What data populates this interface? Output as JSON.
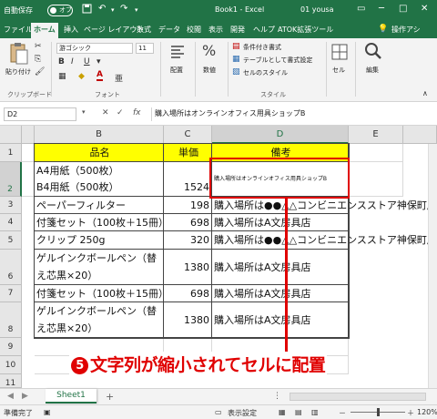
{
  "titlebar": {
    "autosave_label": "自動保存",
    "autosave_state": "オフ",
    "doc_title": "Book1 - Excel",
    "user": "01 yousa",
    "save_icon": "save-icon",
    "undo_icon": "undo-icon",
    "redo_icon": "redo-icon"
  },
  "ribbon_tabs": [
    "ファイル",
    "ホーム",
    "挿入",
    "ページ レイアウト",
    "数式",
    "データ",
    "校閲",
    "表示",
    "開発",
    "ヘルプ",
    "ATOK拡張ツール",
    "操作アシ"
  ],
  "active_tab": "ホーム",
  "ribbon": {
    "paste_label": "貼り付け",
    "clipboard_label": "クリップボード",
    "font_name": "游ゴシック",
    "font_size": "11",
    "bold": "B",
    "italic": "I",
    "underline": "U",
    "font_color_glyph": "A",
    "font_label": "フォント",
    "alignment_label": "配置",
    "number_label": "数値",
    "number_format_glyph": "%",
    "cond_format_label": "条件付き書式",
    "table_format_label": "テーブルとして書式設定",
    "cell_styles_label": "セルのスタイル",
    "styles_label": "スタイル",
    "cells_label": "セル",
    "editing_label": "編集"
  },
  "formula_bar": {
    "name_box": "D2",
    "fx": "fx",
    "content": "購入場所はオンラインオフィス用具ショップB"
  },
  "sheet": {
    "columns": [
      "B",
      "C",
      "D",
      "E"
    ],
    "selected_column": "D",
    "selected_row": "2",
    "headers": {
      "b": "品名",
      "c": "単価",
      "d": "備考"
    },
    "rows": [
      {
        "num": "1",
        "b": "",
        "c": "",
        "d": ""
      },
      {
        "num": "2",
        "b": "A4用紙（500枚）\nB4用紙（500枚）",
        "c": "1524",
        "d": "購入場所はオンラインオフィス用具ショップB"
      },
      {
        "num": "3",
        "b": "ペーパーフィルター",
        "c": "198",
        "d": "購入場所は●●△△コンビニエンスストア神保町店"
      },
      {
        "num": "4",
        "b": "付箋セット（100枚＋15冊）",
        "c": "698",
        "d": "購入場所はA文房具店"
      },
      {
        "num": "5",
        "b": "クリップ 250g",
        "c": "320",
        "d": "購入場所は●●△△コンビニエンスストア神保町店"
      },
      {
        "num": "6",
        "b": "ゲルインクボールペン（替え芯黒×20）",
        "c": "1380",
        "d": "購入場所はA文房具店"
      },
      {
        "num": "7",
        "b": "付箋セット（100枚＋15冊）",
        "c": "698",
        "d": "購入場所はA文房具店"
      },
      {
        "num": "8",
        "b": "ゲルインクボールペン（替え芯黒×20）",
        "c": "1380",
        "d": "購入場所はA文房具店"
      },
      {
        "num": "9",
        "b": "",
        "c": "",
        "d": ""
      },
      {
        "num": "10",
        "b": "",
        "c": "",
        "d": ""
      },
      {
        "num": "11",
        "b": "",
        "c": "",
        "d": ""
      }
    ]
  },
  "annotation": {
    "number": "5",
    "text": "文字列が縮小されてセルに配置"
  },
  "sheet_tabs": {
    "active": "Sheet1",
    "add": "+"
  },
  "status": {
    "ready": "準備完了",
    "display_settings": "表示設定",
    "zoom": "120%",
    "zoom_minus": "－",
    "zoom_plus": "＋"
  },
  "colors": {
    "excel_green": "#217346",
    "highlight": "#ffff00",
    "annotation_red": "#e00000"
  }
}
